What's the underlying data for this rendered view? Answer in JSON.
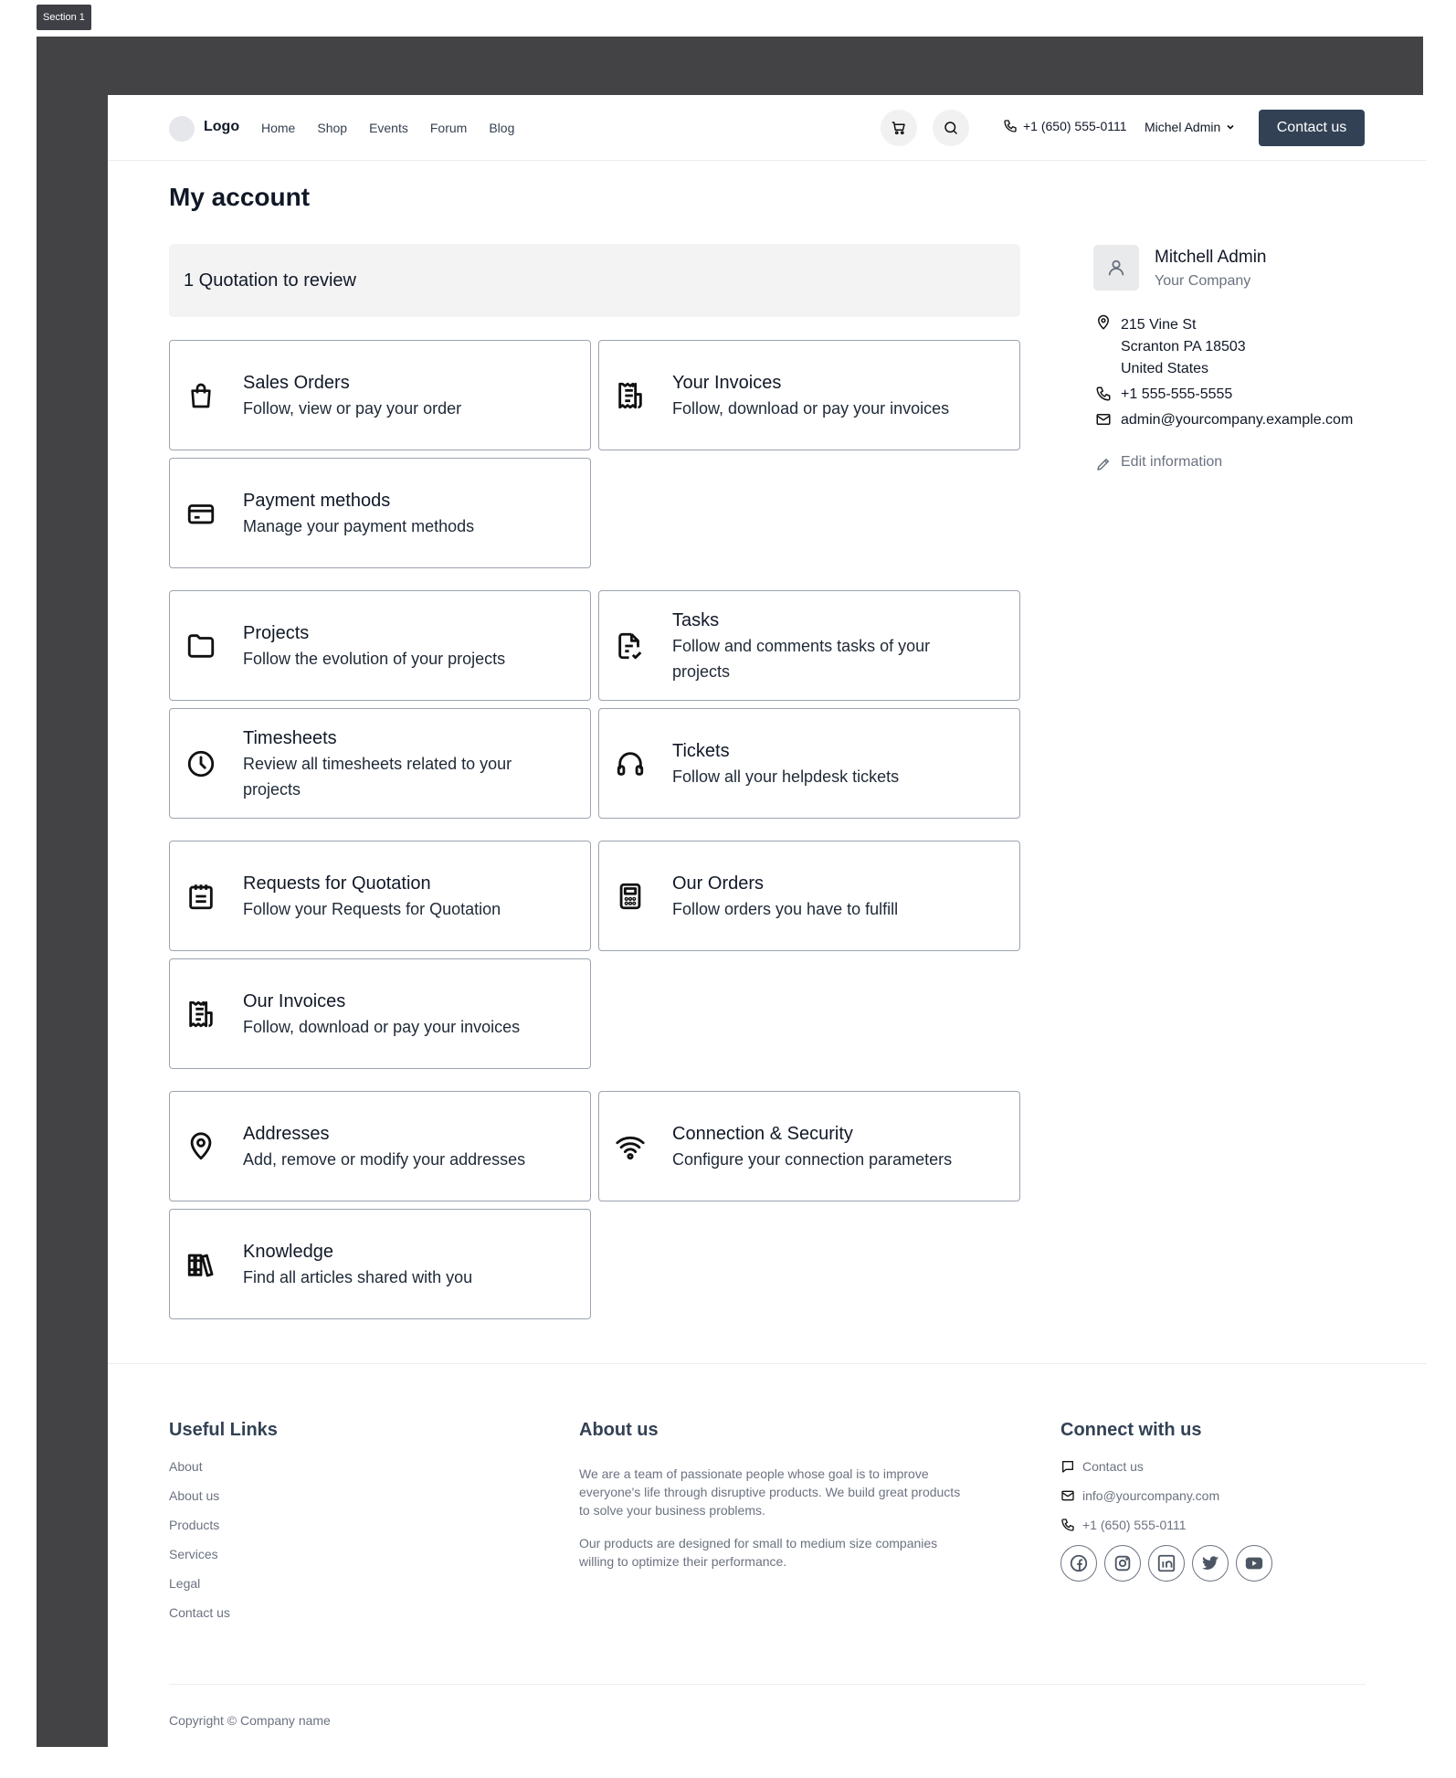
{
  "section_tag": "Section 1",
  "header": {
    "logo": "Logo",
    "nav": [
      "Home",
      "Shop",
      "Events",
      "Forum",
      "Blog"
    ],
    "phone": "+1 (650) 555-0111",
    "user": "Michel Admin",
    "contact_button": "Contact us"
  },
  "main": {
    "title": "My account",
    "quotation_banner": "1 Quotation to review",
    "cards": [
      {
        "icon": "shopping-bag-icon",
        "title": "Sales Orders",
        "desc": "Follow, view or pay your order"
      },
      {
        "icon": "receipt-icon",
        "title": "Your Invoices",
        "desc": "Follow, download or pay your invoices"
      },
      {
        "icon": "credit-card-icon",
        "title": "Payment methods",
        "desc": "Manage your payment methods"
      },
      {
        "icon": "folder-icon",
        "title": "Projects",
        "desc": "Follow the evolution of your projects"
      },
      {
        "icon": "file-check-icon",
        "title": "Tasks",
        "desc": "Follow and comments tasks of your projects"
      },
      {
        "icon": "clock-icon",
        "title": "Timesheets",
        "desc": "Review all timesheets related to your projects"
      },
      {
        "icon": "headphones-icon",
        "title": "Tickets",
        "desc": "Follow all your helpdesk tickets"
      },
      {
        "icon": "notepad-icon",
        "title": "Requests for Quotation",
        "desc": "Follow your Requests for Quotation"
      },
      {
        "icon": "calculator-icon",
        "title": "Our Orders",
        "desc": "Follow orders you have to fulfill"
      },
      {
        "icon": "receipt-icon",
        "title": "Our Invoices",
        "desc": "Follow, download or pay your invoices"
      },
      {
        "icon": "map-pin-icon",
        "title": "Addresses",
        "desc": "Add, remove or modify your addresses"
      },
      {
        "icon": "wifi-icon",
        "title": "Connection & Security",
        "desc": "Configure your connection parameters"
      },
      {
        "icon": "books-icon",
        "title": "Knowledge",
        "desc": "Find all articles shared with you"
      }
    ]
  },
  "profile": {
    "name": "Mitchell Admin",
    "company": "Your Company",
    "address": [
      "215 Vine St",
      "Scranton PA 18503",
      "United States"
    ],
    "phone": "+1 555-555-5555",
    "email": "admin@yourcompany.example.com",
    "edit": "Edit information"
  },
  "footer": {
    "useful_links_title": "Useful Links",
    "useful_links": [
      "About",
      "About us",
      "Products",
      "Services",
      "Legal",
      "Contact us"
    ],
    "about_title": "About us",
    "about_p1": "We are a team of passionate people whose goal is to improve everyone's life through disruptive products. We build great products to solve your business problems.",
    "about_p2": "Our products are designed for small to medium size companies willing to optimize their performance.",
    "connect_title": "Connect with us",
    "connect_contact": "Contact us",
    "connect_email": "info@yourcompany.com",
    "connect_phone": "+1 (650) 555-0111",
    "social": [
      "facebook-icon",
      "instagram-icon",
      "linkedin-icon",
      "twitter-icon",
      "youtube-icon"
    ],
    "copyright": "Copyright © Company name"
  },
  "colors": {
    "frame": "#434345",
    "button": "#334155",
    "muted": "#6b7280"
  }
}
